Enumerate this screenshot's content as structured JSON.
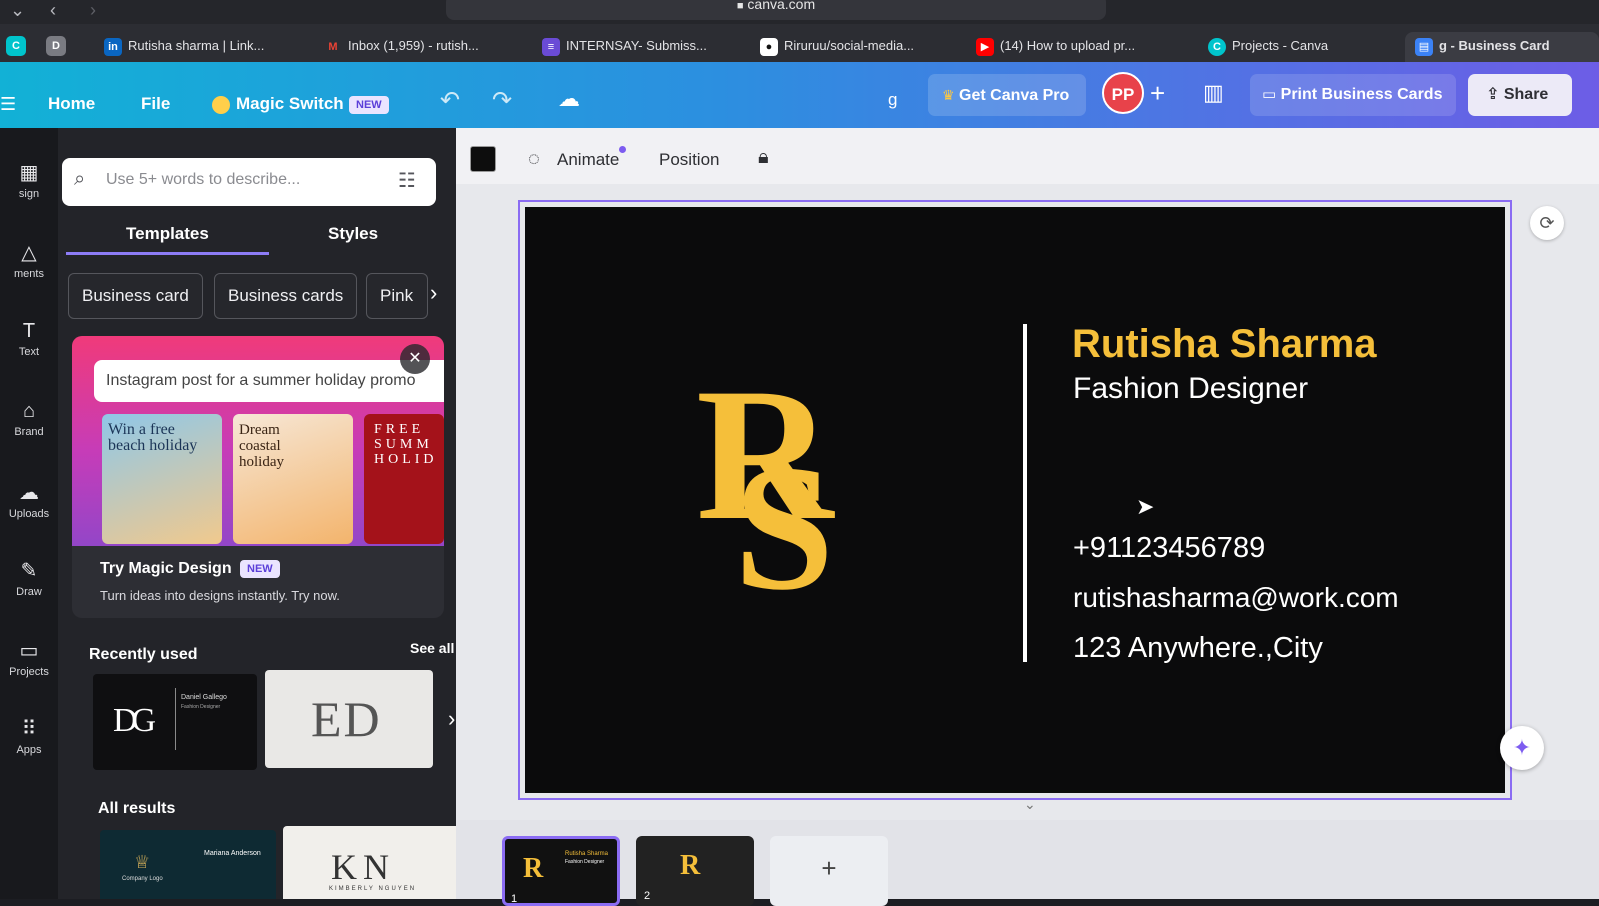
{
  "browser": {
    "url": "canva.com",
    "tabs": [
      {
        "label": "Rutisha sharma | Link...",
        "icon": "linkedin-icon",
        "color": "#0a66c2"
      },
      {
        "label": "Inbox (1,959) - rutish...",
        "icon": "gmail-icon",
        "color": "#ea4335"
      },
      {
        "label": "INTERNSAY- Submiss...",
        "icon": "forms-icon",
        "color": "#6a4bd6"
      },
      {
        "label": "Riruruu/social-media...",
        "icon": "github-icon",
        "color": "#ffffff"
      },
      {
        "label": "(14) How to upload pr...",
        "icon": "youtube-icon",
        "color": "#ff0000"
      },
      {
        "label": "Projects - Canva",
        "icon": "canva-icon",
        "color": "#00c4cc"
      },
      {
        "label": "g - Business Card",
        "icon": "canva-doc-icon",
        "color": "#3b82f6"
      }
    ]
  },
  "header": {
    "home": "Home",
    "file": "File",
    "magic_switch": "Magic Switch",
    "new_badge": "NEW",
    "doc_initial": "g",
    "get_pro": "Get Canva Pro",
    "avatar_initials": "PP",
    "print": "Print Business Cards",
    "share": "Share"
  },
  "rail": {
    "items": [
      {
        "label": "sign",
        "icon": "design-icon"
      },
      {
        "label": "ments",
        "icon": "elements-icon"
      },
      {
        "label": "Text",
        "icon": "text-icon"
      },
      {
        "label": "Brand",
        "icon": "brand-icon"
      },
      {
        "label": "Uploads",
        "icon": "uploads-icon"
      },
      {
        "label": "Draw",
        "icon": "draw-icon"
      },
      {
        "label": "Projects",
        "icon": "projects-icon"
      },
      {
        "label": "Apps",
        "icon": "apps-icon"
      }
    ]
  },
  "panel": {
    "search_placeholder": "Use 5+ words to describe...",
    "tabs": [
      "Templates",
      "Styles"
    ],
    "chips": [
      "Business card",
      "Business cards",
      "Pink"
    ],
    "magic": {
      "prompt": "Instagram post for a summer holiday promo",
      "thumb1": "Win a free beach holiday",
      "thumb2": "Dream coastal holiday",
      "thumb3": "FREE SUMM HOLID",
      "title": "Try Magic Design",
      "badge": "NEW",
      "subtitle": "Turn ideas into designs instantly. Try now."
    },
    "recently_used": "Recently used",
    "see_all": "See all",
    "recent1_monogram": "DG",
    "recent1_name": "Daniel Gallego",
    "recent1_role": "Fashion Designer",
    "recent2_monogram": "ED",
    "all_results": "All results",
    "result1_name": "Mariana Anderson",
    "result1_logo": "Company Logo",
    "result2_monogram": "KN",
    "result2_name": "KIMBERLY NGUYEN"
  },
  "toolbar": {
    "animate": "Animate",
    "position": "Position"
  },
  "card": {
    "monogram_top": "R",
    "monogram_bottom": "S",
    "name": "Rutisha Sharma",
    "title": "Fashion Designer",
    "phone": "+91123456789",
    "email": "rutishasharma@work.com",
    "address": "123 Anywhere.,City"
  },
  "pages": {
    "page1": "1",
    "page2": "2",
    "page1_name": "Rutisha Sharma",
    "page1_title": "Fashion Designer",
    "add": "+"
  },
  "colors": {
    "gold": "#f5bf3a",
    "header_start": "#12b1d6",
    "header_end": "#6d5de6",
    "selection": "#8b6cf3"
  }
}
